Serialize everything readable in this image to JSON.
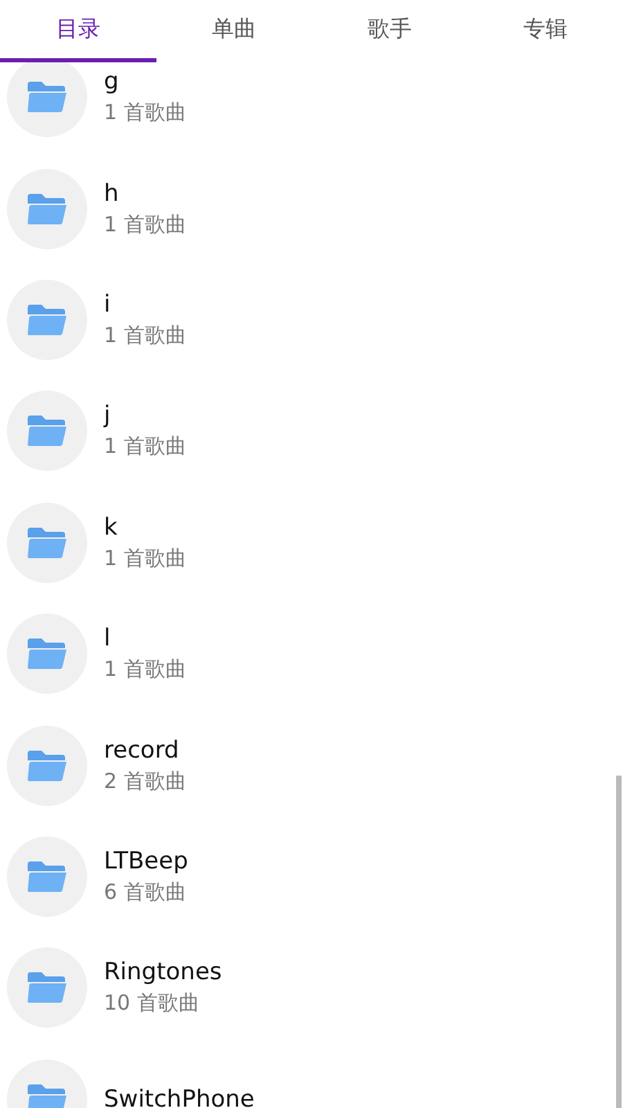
{
  "tabs": [
    {
      "label": "目录",
      "selected": true
    },
    {
      "label": "单曲",
      "selected": false
    },
    {
      "label": "歌手",
      "selected": false
    },
    {
      "label": "专辑",
      "selected": false
    }
  ],
  "folders": [
    {
      "name": "g",
      "count": "1 首歌曲"
    },
    {
      "name": "h",
      "count": "1 首歌曲"
    },
    {
      "name": "i",
      "count": "1 首歌曲"
    },
    {
      "name": "j",
      "count": "1 首歌曲"
    },
    {
      "name": "k",
      "count": "1 首歌曲"
    },
    {
      "name": "l",
      "count": "1 首歌曲"
    },
    {
      "name": "record",
      "count": "2 首歌曲"
    },
    {
      "name": "LTBeep",
      "count": "6 首歌曲"
    },
    {
      "name": "Ringtones",
      "count": "10 首歌曲"
    },
    {
      "name": "SwitchPhone"
    }
  ]
}
